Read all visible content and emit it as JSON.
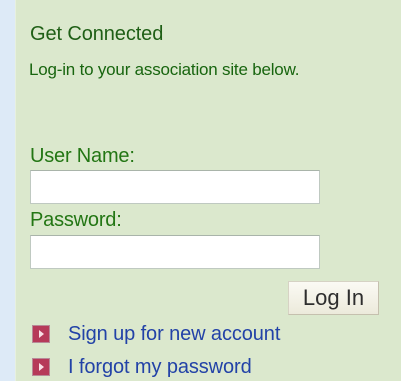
{
  "login_panel": {
    "heading": "Get Connected",
    "subtext": "Log-in to your association site below.",
    "username": {
      "label": "User Name:",
      "value": "",
      "placeholder": ""
    },
    "password": {
      "label": "Password:",
      "value": "",
      "placeholder": ""
    },
    "login_button_label": "Log In",
    "links": [
      {
        "label": "Sign up for new account",
        "icon": "arrow-bullet-icon"
      },
      {
        "label": "I forgot my password",
        "icon": "arrow-bullet-icon"
      }
    ]
  },
  "colors": {
    "page_background": "#ddeaf7",
    "panel_background": "#dbe8cd",
    "heading_green": "#1f5f16",
    "link_blue": "#2242a7",
    "bullet_red": "#b63a59"
  }
}
